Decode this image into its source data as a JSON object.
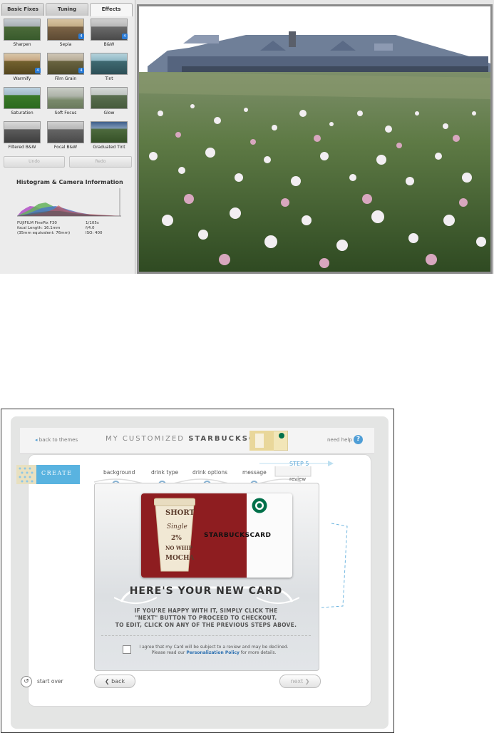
{
  "editor": {
    "tabs": [
      {
        "label": "Basic Fixes"
      },
      {
        "label": "Tuning"
      },
      {
        "label": "Effects"
      }
    ],
    "effects": [
      {
        "name": "Sharpen",
        "badge": ""
      },
      {
        "name": "Sepia",
        "badge": "4"
      },
      {
        "name": "B&W",
        "badge": "4"
      },
      {
        "name": "Warmify",
        "badge": "4"
      },
      {
        "name": "Film Grain",
        "badge": "4"
      },
      {
        "name": "Tint",
        "badge": ""
      },
      {
        "name": "Saturation",
        "badge": ""
      },
      {
        "name": "Soft Focus",
        "badge": ""
      },
      {
        "name": "Glow",
        "badge": ""
      },
      {
        "name": "Filtered B&W",
        "badge": ""
      },
      {
        "name": "Focal B&W",
        "badge": ""
      },
      {
        "name": "Graduated Tint",
        "badge": ""
      }
    ],
    "undo_label": "Undo",
    "redo_label": "Redo",
    "histogram_title": "Histogram & Camera Information",
    "camera": {
      "model": "FUJIFILM FinePix F30",
      "focal": "focal Length: 16.1mm",
      "equiv": "(35mm equivalent: 76mm)",
      "shutter": "1/105s",
      "aperture": "f/4.0",
      "iso": "ISO: 400"
    }
  },
  "card_builder": {
    "back_to_themes": "back to themes",
    "title_prefix": "MY CUSTOMIZED",
    "title_brand": "STARBUCKSCARD",
    "need_help": "need help",
    "help_icon": "?",
    "create_label": "CREATE",
    "steps": [
      {
        "label": "background"
      },
      {
        "label": "drink type"
      },
      {
        "label": "drink options"
      },
      {
        "label": "message"
      }
    ],
    "step5_label": "STEP 5",
    "review_label": "review",
    "card_brand": "STARBUCKSCARD",
    "cup_lines": [
      "SHORT",
      "Single",
      "2%",
      "NO WHIP",
      "MOCHA"
    ],
    "headline": "HERE'S YOUR NEW CARD",
    "desc_line1": "IF YOU'RE HAPPY WITH IT, SIMPLY CLICK THE",
    "desc_line2": "\"NEXT\" BUTTON TO PROCEED TO CHECKOUT.",
    "desc_line3": "TO EDIT, CLICK ON ANY OF THE PREVIOUS STEPS ABOVE.",
    "agree_line1": "I agree that my Card will be subject to a review and may be declined.",
    "agree_line2_prefix": "Please read our",
    "agree_link": "Personalization Policy",
    "agree_line2_suffix": "for more details.",
    "start_over": "start over",
    "back_label": "back",
    "next_label": "next",
    "colors": {
      "accent_blue": "#5aa6d6",
      "card_red": "#8e1d20",
      "starbucks_green": "#00704a"
    }
  }
}
